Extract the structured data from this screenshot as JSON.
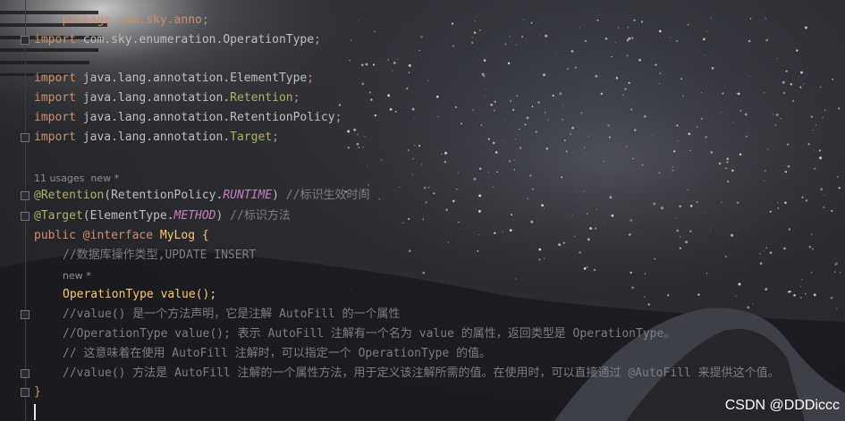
{
  "code_lines": {
    "package": "package com.sky.anno;",
    "import_op_kw": "import",
    "import_op_path": " com.sky.enumeration.OperationType",
    "semicolon": ";",
    "import_kw": "import",
    "import_elementtype": " java.lang.annotation.ElementType",
    "import_retention_pkg": " java.lang.annotation.",
    "import_retention_cls": "Retention",
    "import_retentionpolicy": " java.lang.annotation.RetentionPolicy",
    "import_target_pkg": " java.lang.annotation.",
    "import_target_cls": "Target"
  },
  "hints": {
    "usages": "11 usages  new *",
    "method_new": "new *"
  },
  "annotations": {
    "retention": "@Retention",
    "retention_arg_open": "(RetentionPolicy.",
    "retention_value": "RUNTIME",
    "retention_close": ")",
    "retention_comment": " //标识生效时间",
    "target": "@Target",
    "target_arg_open": "(ElementType.",
    "target_value": "METHOD",
    "target_close": ")",
    "target_comment": " //标识方法"
  },
  "declaration": {
    "public": "public ",
    "at_interface": "@interface",
    "name": " MyLog {",
    "comment_type": "//数据库操作类型,UPDATE INSERT",
    "return_type": "OperationType ",
    "method": "value",
    "method_end": "();",
    "comment1": "//value() 是一个方法声明，它是注解 AutoFill 的一个属性",
    "comment2": "//OperationType value(); 表示 AutoFill 注解有一个名为 value 的属性，返回类型是 OperationType。",
    "comment3": "// 这意味着在使用 AutoFill 注解时，可以指定一个 OperationType 的值。",
    "comment4": "//value() 方法是 AutoFill 注解的一个属性方法，用于定义该注解所需的值。在使用时，可以直接通过 @AutoFill 来提供这个值。",
    "close": "}"
  },
  "watermark": "CSDN @DDDiccc"
}
